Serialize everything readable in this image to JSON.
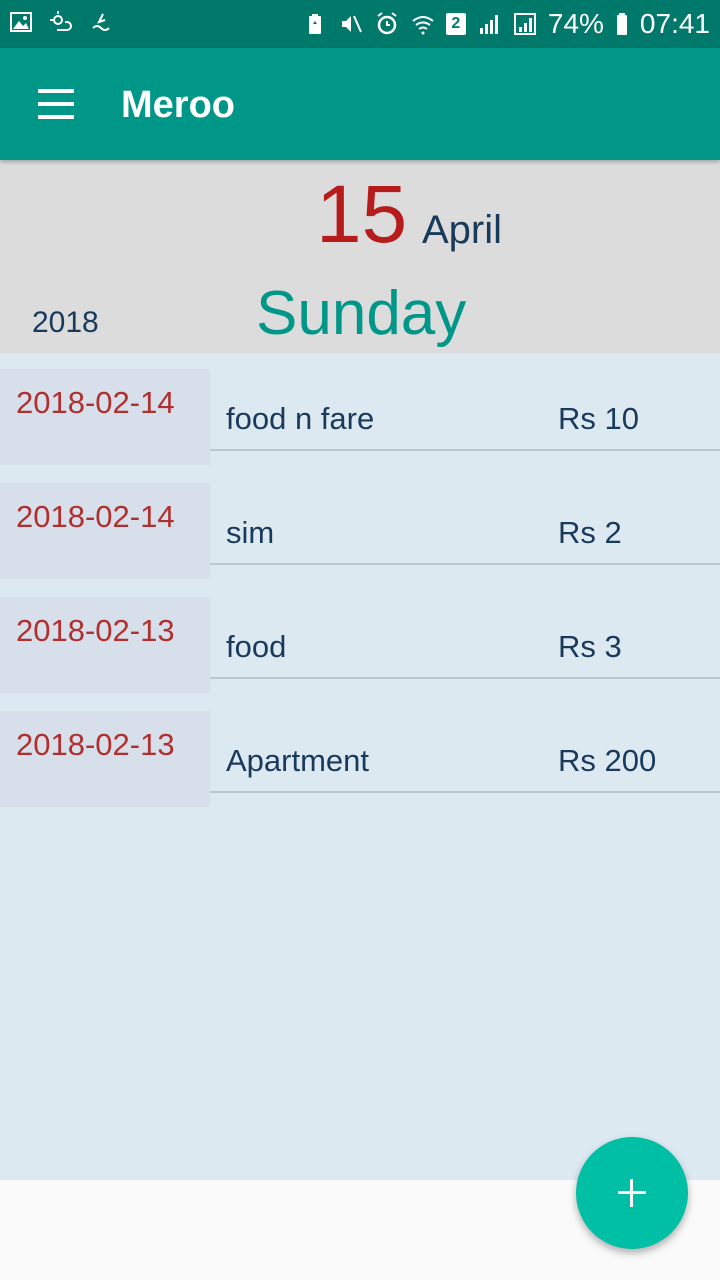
{
  "status_bar": {
    "battery": "74%",
    "time": "07:41",
    "sim_slot": "2",
    "icons": [
      "image-icon",
      "weather-icon",
      "gesture-icon",
      "battery-saver-icon",
      "mute-icon",
      "alarm-icon",
      "wifi-icon",
      "signal-icon",
      "signal-icon",
      "battery-icon"
    ]
  },
  "app_bar": {
    "title": "Meroo",
    "menu_icon": "hamburger-menu-icon"
  },
  "date_header": {
    "day": "15",
    "month": "April",
    "year": "2018",
    "weekday": "Sunday"
  },
  "expenses": [
    {
      "date": "2018-02-14",
      "description": "food n fare",
      "amount": "Rs 10"
    },
    {
      "date": "2018-02-14",
      "description": "sim",
      "amount": "Rs 2"
    },
    {
      "date": "2018-02-13",
      "description": "food",
      "amount": "Rs 3"
    },
    {
      "date": "2018-02-13",
      "description": "Apartment",
      "amount": "Rs 200"
    }
  ],
  "fab": {
    "icon": "plus-icon"
  },
  "colors": {
    "primary": "#009688",
    "primary_dark": "#00796b",
    "accent": "#00bfa5",
    "date_red": "#b03030",
    "text_navy": "#1a3a5c"
  }
}
